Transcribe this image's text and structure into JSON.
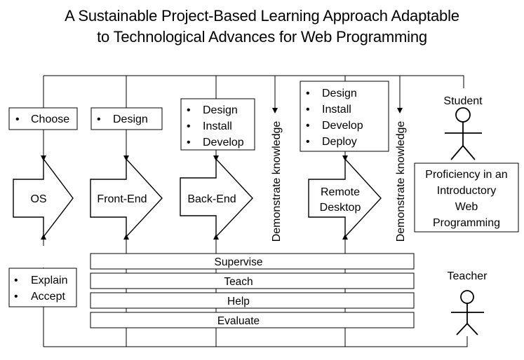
{
  "title": {
    "line1": "A Sustainable Project-Based Learning Approach Adaptable",
    "line2": "to Technological Advances for Web Programming"
  },
  "stages": [
    {
      "label": "OS",
      "tasks": [
        "Choose"
      ]
    },
    {
      "label": "Front-End",
      "tasks": [
        "Design"
      ]
    },
    {
      "label": "Back-End",
      "tasks": [
        "Design",
        "Install",
        "Develop"
      ]
    },
    {
      "label_lines": [
        "Remote",
        "Desktop"
      ],
      "tasks": [
        "Design",
        "Install",
        "Develop",
        "Deploy"
      ]
    }
  ],
  "checkpoints": [
    "Demonstrate knowledge",
    "Demonstrate knowledge"
  ],
  "os_teacher_tasks": [
    "Explain",
    "Accept"
  ],
  "teacher_roles": [
    "Supervise",
    "Teach",
    "Help",
    "Evaluate"
  ],
  "actors": {
    "student": "Student",
    "teacher": "Teacher"
  },
  "outcome": [
    "Proficiency in an",
    "Introductory",
    "Web",
    "Programming"
  ],
  "bullet": "•"
}
